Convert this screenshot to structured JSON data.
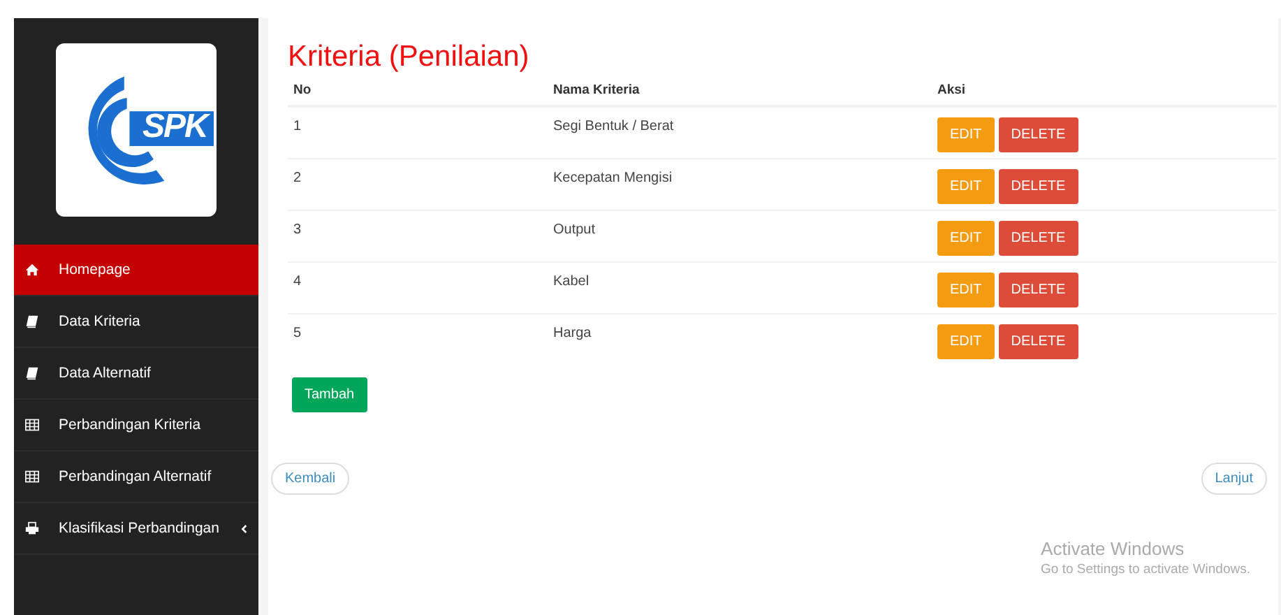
{
  "sidebar": {
    "logo_text": "SPK",
    "items": [
      {
        "label": "Homepage",
        "kind": "home",
        "selected": true,
        "has_submenu": false
      },
      {
        "label": "Data Kriteria",
        "kind": "book",
        "selected": false,
        "has_submenu": false
      },
      {
        "label": "Data Alternatif",
        "kind": "book",
        "selected": false,
        "has_submenu": false
      },
      {
        "label": "Perbandingan Kriteria",
        "kind": "table",
        "selected": false,
        "has_submenu": false
      },
      {
        "label": "Perbandingan Alternatif",
        "kind": "table",
        "selected": false,
        "has_submenu": false
      },
      {
        "label": "Klasifikasi Perbandingan",
        "kind": "printer",
        "selected": false,
        "has_submenu": true
      }
    ]
  },
  "title": "Kriteria (Penilaian)",
  "table": {
    "columns": [
      "No",
      "Nama Kriteria",
      "Aksi"
    ],
    "rows": [
      {
        "no": "1",
        "name": "Segi Bentuk / Berat",
        "actions": [
          "EDIT",
          "DELETE"
        ]
      },
      {
        "no": "2",
        "name": "Kecepatan Mengisi",
        "actions": [
          "EDIT",
          "DELETE"
        ]
      },
      {
        "no": "3",
        "name": "Output",
        "actions": [
          "EDIT",
          "DELETE"
        ]
      },
      {
        "no": "4",
        "name": "Kabel",
        "actions": [
          "EDIT",
          "DELETE"
        ]
      },
      {
        "no": "5",
        "name": "Harga",
        "actions": [
          "EDIT",
          "DELETE"
        ]
      }
    ]
  },
  "add_button": "Tambah",
  "back_button": "Kembali",
  "next_button": "Lanjut",
  "os_notice": {
    "title": "Activate Windows",
    "subtitle": "Go to Settings to activate Windows."
  }
}
